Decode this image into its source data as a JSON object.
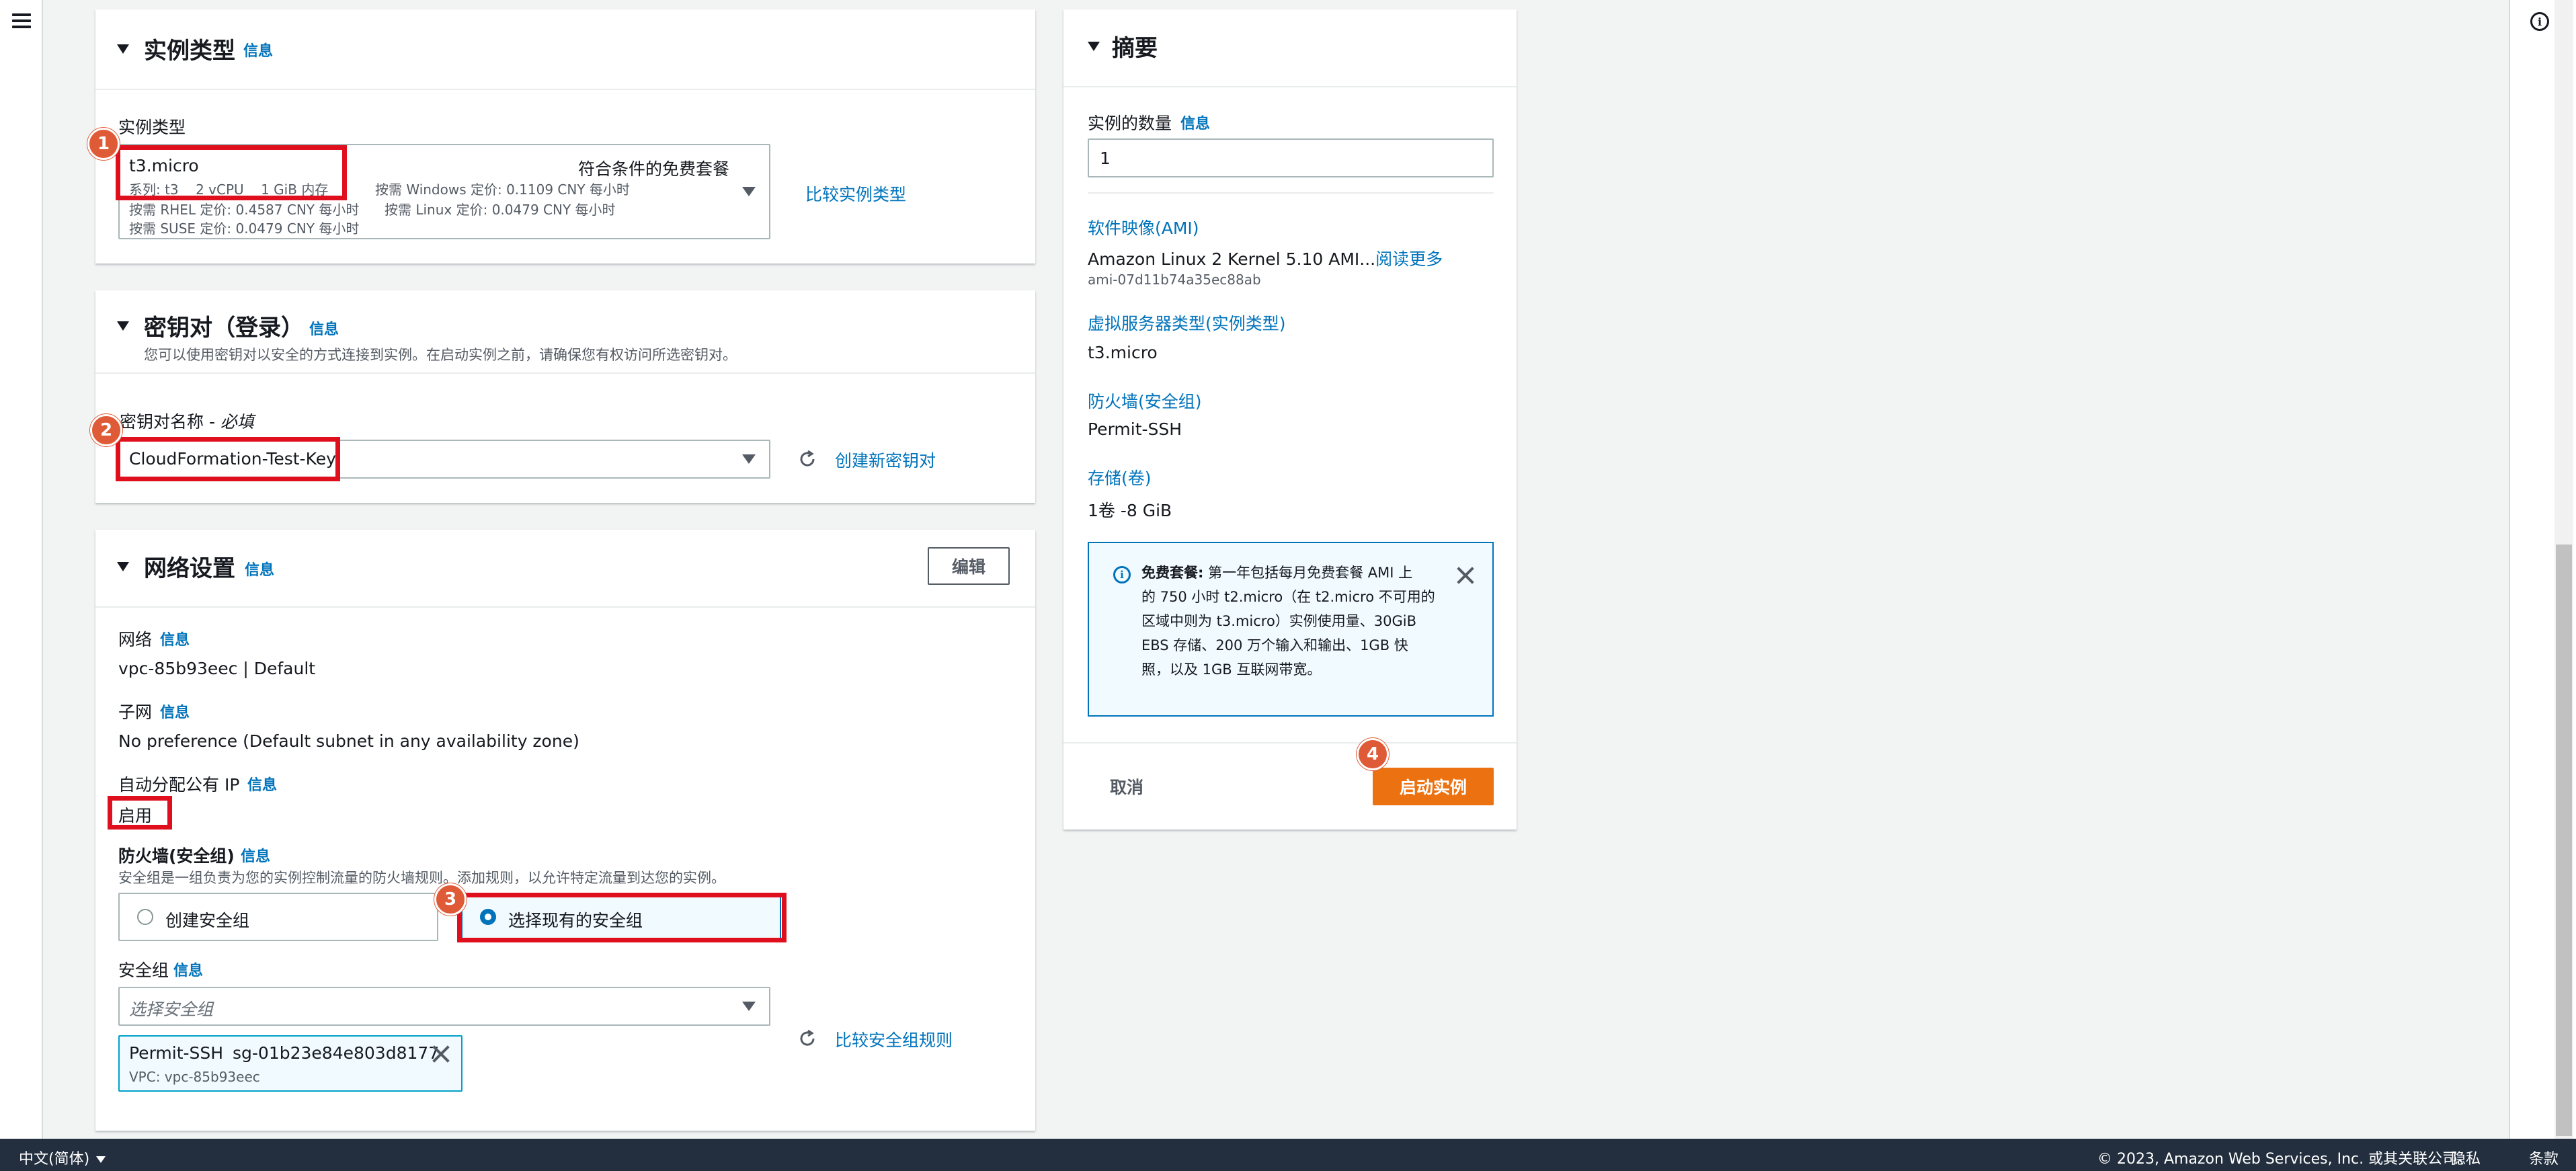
{
  "instance_type_panel": {
    "title": "实例类型",
    "info": "信息",
    "field_label": "实例类型",
    "selected_name": "t3.micro",
    "free_tier": "符合条件的免费套餐",
    "spec_line": "系列: t3    2 vCPU    1 GiB 内存",
    "windows_price": "按需 Windows 定价: 0.1109 CNY 每小时",
    "rhel_price": "按需 RHEL 定价: 0.4587 CNY 每小时",
    "linux_price": "按需 Linux 定价: 0.0479 CNY 每小时",
    "suse_price": "按需 SUSE 定价: 0.0479 CNY 每小时",
    "compare_link": "比较实例类型"
  },
  "key_pair_panel": {
    "title": "密钥对（登录）",
    "info": "信息",
    "description": "您可以使用密钥对以安全的方式连接到实例。在启动实例之前，请确保您有权访问所选密钥对。",
    "field_label": "密钥对名称 - ",
    "field_required": "必填",
    "selected_value": "CloudFormation-Test-Key",
    "create_link": "创建新密钥对"
  },
  "network_panel": {
    "title": "网络设置",
    "info": "信息",
    "edit_button": "编辑",
    "network_label": "网络",
    "network_info": "信息",
    "network_value": "vpc-85b93eec | Default",
    "subnet_label": "子网",
    "subnet_info": "信息",
    "subnet_value": "No preference (Default subnet in any availability zone)",
    "auto_ip_label": "自动分配公有 IP",
    "auto_ip_info": "信息",
    "auto_ip_value": "启用",
    "firewall_label": "防火墙(安全组)",
    "firewall_info": "信息",
    "firewall_desc": "安全组是一组负责为您的实例控制流量的防火墙规则。添加规则，以允许特定流量到达您的实例。",
    "radio_create": "创建安全组",
    "radio_existing": "选择现有的安全组",
    "sg_label": "安全组",
    "sg_info": "信息",
    "sg_placeholder": "选择安全组",
    "sg_compare_link": "比较安全组规则",
    "token_name": "Permit-SSH",
    "token_id": "sg-01b23e84e803d8177",
    "token_vpc": "VPC: vpc-85b93eec"
  },
  "summary_panel": {
    "title": "摘要",
    "count_label": "实例的数量",
    "count_info": "信息",
    "count_value": "1",
    "ami_label": "软件映像(AMI)",
    "ami_value": "Amazon Linux 2 Kernel 5.10 AMI...",
    "ami_read_more": "阅读更多",
    "ami_id": "ami-07d11b74a35ec88ab",
    "server_type_label": "虚拟服务器类型(实例类型)",
    "server_type_value": "t3.micro",
    "firewall_label": "防火墙(安全组)",
    "firewall_value": "Permit-SSH",
    "storage_label": "存储(卷)",
    "storage_value": "1卷 -8 GiB",
    "alert_bold": "免费套餐:",
    "alert_line1": "第一年包括每月免费套餐 AMI 上",
    "alert_line2": "的 750 小时 t2.micro（在 t2.micro 不可用的",
    "alert_line3": "区域中则为 t3.micro）实例使用量、30GiB",
    "alert_line4": "EBS 存储、200 万个输入和输出、1GB 快",
    "alert_line5": "照，以及 1GB 互联网带宽。",
    "cancel_button": "取消",
    "launch_button": "启动实例"
  },
  "badges": [
    "1",
    "2",
    "3",
    "4"
  ],
  "footer": {
    "language": "中文(简体)",
    "copyright": "© 2023, Amazon Web Services, Inc. 或其关联公司。",
    "privacy": "隐私",
    "terms": "条款"
  },
  "colors": {
    "accent": "#0073bb",
    "primary_button": "#ec7211",
    "highlight": "#e00f1d",
    "badge": "#df5a36",
    "footer_bg": "#232f3e"
  }
}
